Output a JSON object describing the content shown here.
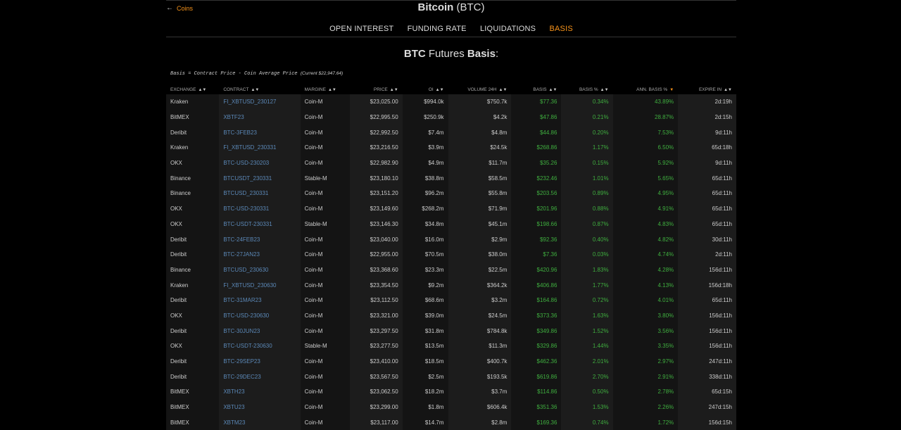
{
  "nav": {
    "back_label": "Coins"
  },
  "header": {
    "coin_name": "Bitcoin",
    "coin_ticker": "(BTC)"
  },
  "tabs": [
    {
      "label": "OPEN INTEREST",
      "active": false
    },
    {
      "label": "FUNDING RATE",
      "active": false
    },
    {
      "label": "LIQUIDATIONS",
      "active": false
    },
    {
      "label": "BASIS",
      "active": true
    }
  ],
  "subtitle": {
    "symbol": "BTC",
    "mid": "Futures",
    "word": "Basis",
    "colon": ":"
  },
  "formula": {
    "text": "Basis = Contract Price - Coin Average Price",
    "current": "(Current $22,947.64)"
  },
  "colors": {
    "accent": "#f7931a",
    "link": "#5b88b7",
    "positive": "#3fae3f"
  },
  "table": {
    "sort_indicator": "▲▼",
    "sorted_indicator": "▼",
    "columns": [
      "EXCHANGE",
      "CONTRACT",
      "MARGINE",
      "PRICE",
      "OI",
      "VOLUME 24H",
      "BASIS",
      "BASIS %",
      "ANN. BASIS %",
      "EXPIRE IN"
    ],
    "sorted_column": 8,
    "rows": [
      [
        "Kraken",
        "FI_XBTUSD_230127",
        "Coin-M",
        "$23,025.00",
        "$994.0k",
        "$750.7k",
        "$77.36",
        "0.34%",
        "43.89%",
        "2d:19h"
      ],
      [
        "BitMEX",
        "XBTF23",
        "Coin-M",
        "$22,995.50",
        "$250.9k",
        "$4.2k",
        "$47.86",
        "0.21%",
        "28.87%",
        "2d:15h"
      ],
      [
        "Deribit",
        "BTC-3FEB23",
        "Coin-M",
        "$22,992.50",
        "$7.4m",
        "$4.8m",
        "$44.86",
        "0.20%",
        "7.53%",
        "9d:11h"
      ],
      [
        "Kraken",
        "FI_XBTUSD_230331",
        "Coin-M",
        "$23,216.50",
        "$3.9m",
        "$24.5k",
        "$268.86",
        "1.17%",
        "6.50%",
        "65d:18h"
      ],
      [
        "OKX",
        "BTC-USD-230203",
        "Coin-M",
        "$22,982.90",
        "$4.9m",
        "$11.7m",
        "$35.26",
        "0.15%",
        "5.92%",
        "9d:11h"
      ],
      [
        "Binance",
        "BTCUSDT_230331",
        "Stable-M",
        "$23,180.10",
        "$38.8m",
        "$58.5m",
        "$232.46",
        "1.01%",
        "5.65%",
        "65d:11h"
      ],
      [
        "Binance",
        "BTCUSD_230331",
        "Coin-M",
        "$23,151.20",
        "$96.2m",
        "$55.8m",
        "$203.56",
        "0.89%",
        "4.95%",
        "65d:11h"
      ],
      [
        "OKX",
        "BTC-USD-230331",
        "Coin-M",
        "$23,149.60",
        "$268.2m",
        "$71.9m",
        "$201.96",
        "0.88%",
        "4.91%",
        "65d:11h"
      ],
      [
        "OKX",
        "BTC-USDT-230331",
        "Stable-M",
        "$23,146.30",
        "$34.8m",
        "$45.1m",
        "$198.66",
        "0.87%",
        "4.83%",
        "65d:11h"
      ],
      [
        "Deribit",
        "BTC-24FEB23",
        "Coin-M",
        "$23,040.00",
        "$16.0m",
        "$2.9m",
        "$92.36",
        "0.40%",
        "4.82%",
        "30d:11h"
      ],
      [
        "Deribit",
        "BTC-27JAN23",
        "Coin-M",
        "$22,955.00",
        "$70.5m",
        "$38.0m",
        "$7.36",
        "0.03%",
        "4.74%",
        "2d:11h"
      ],
      [
        "Binance",
        "BTCUSD_230630",
        "Coin-M",
        "$23,368.60",
        "$23.3m",
        "$22.5m",
        "$420.96",
        "1.83%",
        "4.28%",
        "156d:11h"
      ],
      [
        "Kraken",
        "FI_XBTUSD_230630",
        "Coin-M",
        "$23,354.50",
        "$9.2m",
        "$364.2k",
        "$406.86",
        "1.77%",
        "4.13%",
        "156d:18h"
      ],
      [
        "Deribit",
        "BTC-31MAR23",
        "Coin-M",
        "$23,112.50",
        "$68.6m",
        "$3.2m",
        "$164.86",
        "0.72%",
        "4.01%",
        "65d:11h"
      ],
      [
        "OKX",
        "BTC-USD-230630",
        "Coin-M",
        "$23,321.00",
        "$39.0m",
        "$24.5m",
        "$373.36",
        "1.63%",
        "3.80%",
        "156d:11h"
      ],
      [
        "Deribit",
        "BTC-30JUN23",
        "Coin-M",
        "$23,297.50",
        "$31.8m",
        "$784.8k",
        "$349.86",
        "1.52%",
        "3.56%",
        "156d:11h"
      ],
      [
        "OKX",
        "BTC-USDT-230630",
        "Stable-M",
        "$23,277.50",
        "$13.5m",
        "$11.3m",
        "$329.86",
        "1.44%",
        "3.35%",
        "156d:11h"
      ],
      [
        "Deribit",
        "BTC-29SEP23",
        "Coin-M",
        "$23,410.00",
        "$18.5m",
        "$400.7k",
        "$462.36",
        "2.01%",
        "2.97%",
        "247d:11h"
      ],
      [
        "Deribit",
        "BTC-29DEC23",
        "Coin-M",
        "$23,567.50",
        "$2.5m",
        "$193.5k",
        "$619.86",
        "2.70%",
        "2.91%",
        "338d:11h"
      ],
      [
        "BitMEX",
        "XBTH23",
        "Coin-M",
        "$23,062.50",
        "$18.2m",
        "$3.7m",
        "$114.86",
        "0.50%",
        "2.78%",
        "65d:15h"
      ],
      [
        "BitMEX",
        "XBTU23",
        "Coin-M",
        "$23,299.00",
        "$1.8m",
        "$606.4k",
        "$351.36",
        "1.53%",
        "2.26%",
        "247d:15h"
      ],
      [
        "BitMEX",
        "XBTM23",
        "Coin-M",
        "$23,117.00",
        "$14.7m",
        "$2.8m",
        "$169.36",
        "0.74%",
        "1.72%",
        "156d:15h"
      ]
    ]
  }
}
